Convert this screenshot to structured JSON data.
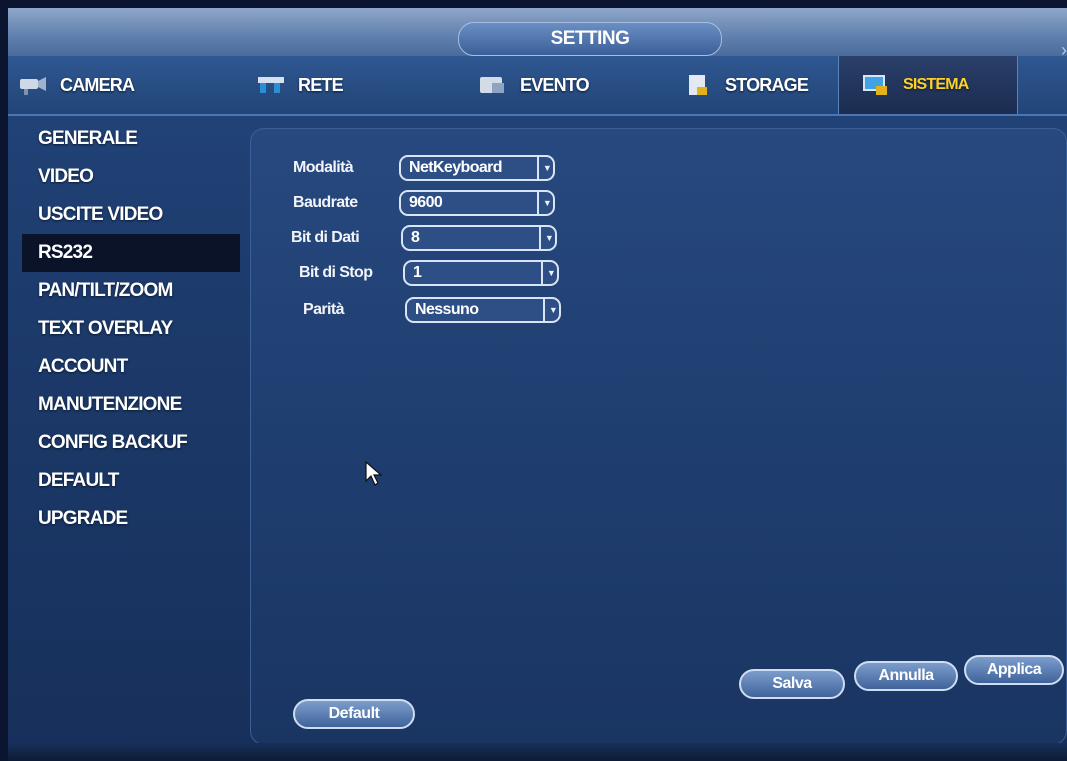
{
  "window": {
    "title": "SETTING"
  },
  "tabs": [
    {
      "label": "CAMERA",
      "icon": "camera-icon"
    },
    {
      "label": "RETE",
      "icon": "network-icon"
    },
    {
      "label": "EVENTO",
      "icon": "event-icon"
    },
    {
      "label": "STORAGE",
      "icon": "storage-icon"
    },
    {
      "label": "SISTEMA",
      "icon": "system-icon",
      "active": true
    }
  ],
  "sidebar": {
    "items": [
      {
        "label": "GENERALE"
      },
      {
        "label": "VIDEO"
      },
      {
        "label": "USCITE VIDEO"
      },
      {
        "label": "RS232",
        "active": true
      },
      {
        "label": "PAN/TILT/ZOOM"
      },
      {
        "label": "TEXT OVERLAY"
      },
      {
        "label": "ACCOUNT"
      },
      {
        "label": "MANUTENZIONE"
      },
      {
        "label": "CONFIG BACKUF"
      },
      {
        "label": "DEFAULT"
      },
      {
        "label": "UPGRADE"
      }
    ]
  },
  "form": {
    "fields": [
      {
        "label": "Modalità",
        "value": "NetKeyboard"
      },
      {
        "label": "Baudrate",
        "value": "9600"
      },
      {
        "label": "Bit di Dati",
        "value": "8"
      },
      {
        "label": "Bit di Stop",
        "value": "1"
      },
      {
        "label": "Parità",
        "value": "Nessuno"
      }
    ]
  },
  "buttons": {
    "default": "Default",
    "salva": "Salva",
    "annulla": "Annulla",
    "applica": "Applica"
  },
  "colors": {
    "active_tab_text": "#ffd02a",
    "panel_bg": "#1f3e70",
    "active_sidebar_bg": "#0b1328"
  }
}
